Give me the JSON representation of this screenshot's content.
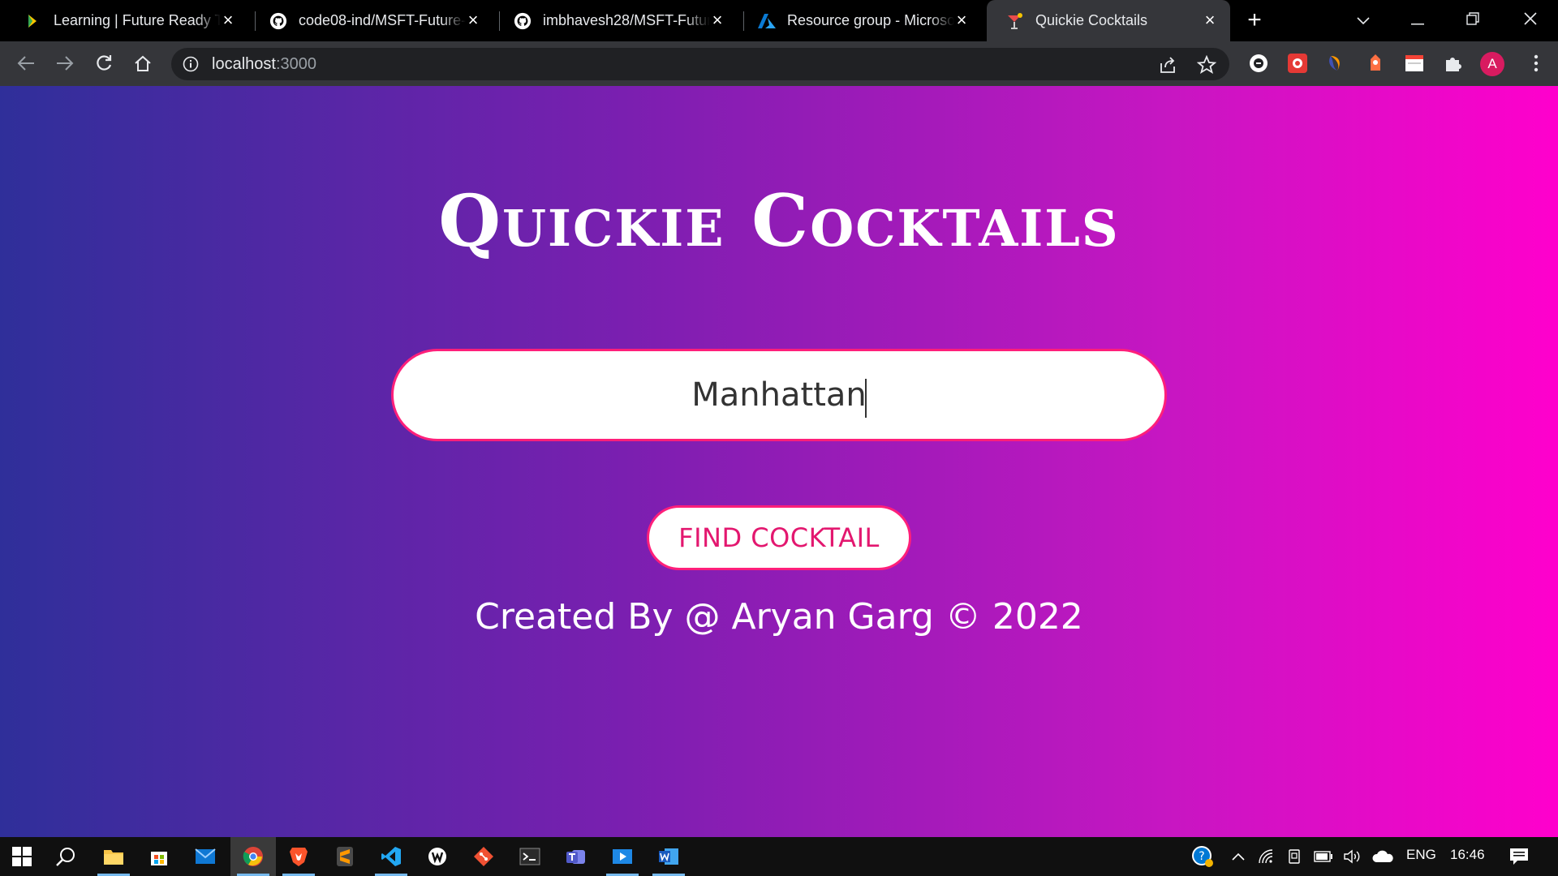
{
  "browser": {
    "tabs": [
      {
        "title": "Learning | Future Ready Ta",
        "icon": "learning-icon",
        "active": false
      },
      {
        "title": "code08-ind/MSFT-Future-",
        "icon": "github-icon",
        "active": false
      },
      {
        "title": "imbhavesh28/MSFT-Futur",
        "icon": "github-icon",
        "active": false
      },
      {
        "title": "Resource group - Microso",
        "icon": "azure-icon",
        "active": false
      },
      {
        "title": "Quickie Cocktails",
        "icon": "cocktail-icon",
        "active": true
      }
    ],
    "new_tab_label": "+",
    "address": {
      "host": "localhost",
      "port": ":3000"
    },
    "profile_initial": "A"
  },
  "page": {
    "title": "Quickie Cocktails",
    "search_value": "Manhattan",
    "find_button_label": "FIND COCKTAIL",
    "credit": "Created By @ Aryan Garg © 2022"
  },
  "taskbar": {
    "language": "ENG",
    "time": "16:46"
  },
  "colors": {
    "gradient_start": "#2f2f9a",
    "gradient_end": "#ff00cc",
    "accent": "#ff1f7a"
  }
}
